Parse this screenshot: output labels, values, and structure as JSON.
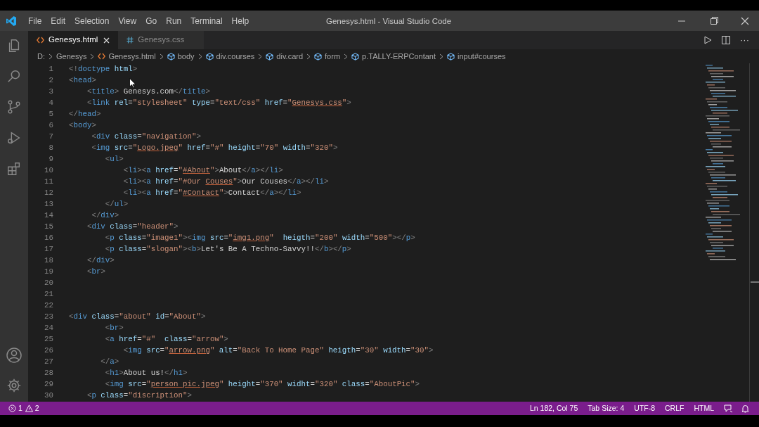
{
  "window": {
    "title": "Genesys.html - Visual Studio Code"
  },
  "menu": [
    "File",
    "Edit",
    "Selection",
    "View",
    "Go",
    "Run",
    "Terminal",
    "Help"
  ],
  "tabs": [
    {
      "label": "Genesys.html",
      "kind": "html",
      "selected": true
    },
    {
      "label": "Genesys.css",
      "kind": "css",
      "selected": false
    }
  ],
  "more_actions": "···",
  "breadcrumbs": [
    {
      "label": "D:",
      "kind": "folder"
    },
    {
      "label": "Genesys",
      "kind": "folder"
    },
    {
      "label": "Genesys.html",
      "kind": "html"
    },
    {
      "label": "body",
      "kind": "symbol"
    },
    {
      "label": "div.courses",
      "kind": "symbol"
    },
    {
      "label": "div.card",
      "kind": "symbol"
    },
    {
      "label": "form",
      "kind": "symbol"
    },
    {
      "label": "p.TALLY-ERPContant",
      "kind": "symbol"
    },
    {
      "label": "input#courses",
      "kind": "symbol"
    }
  ],
  "editor": {
    "lines": [
      {
        "number": "1",
        "tokens": [
          {
            "kind": "punct",
            "text": "<!"
          },
          {
            "kind": "tag",
            "text": "doctype"
          },
          {
            "kind": "attr",
            "text": " html"
          },
          {
            "kind": "punct",
            "text": ">"
          }
        ]
      },
      {
        "number": "2",
        "tokens": [
          {
            "kind": "punct",
            "text": "<"
          },
          {
            "kind": "tag",
            "text": "head"
          },
          {
            "kind": "punct",
            "text": ">"
          }
        ]
      },
      {
        "number": "3",
        "tokens": [
          {
            "kind": "punct",
            "text": "    <"
          },
          {
            "kind": "tag",
            "text": "title"
          },
          {
            "kind": "punct",
            "text": ">"
          },
          {
            "kind": "text",
            "text": " Genesys.com"
          },
          {
            "kind": "punct",
            "text": "</"
          },
          {
            "kind": "tag",
            "text": "title"
          },
          {
            "kind": "punct",
            "text": ">"
          }
        ]
      },
      {
        "number": "4",
        "tokens": [
          {
            "kind": "punct",
            "text": "    <"
          },
          {
            "kind": "tag",
            "text": "link"
          },
          {
            "kind": "attr",
            "text": " rel"
          },
          {
            "kind": "text",
            "text": "="
          },
          {
            "kind": "string",
            "text": "\"stylesheet\""
          },
          {
            "kind": "attr",
            "text": " type"
          },
          {
            "kind": "text",
            "text": "="
          },
          {
            "kind": "string",
            "text": "\"text/css\""
          },
          {
            "kind": "attr",
            "text": " href"
          },
          {
            "kind": "text",
            "text": "="
          },
          {
            "kind": "string",
            "text": "\""
          },
          {
            "kind": "link",
            "text": "Genesys.css"
          },
          {
            "kind": "string",
            "text": "\""
          },
          {
            "kind": "punct",
            "text": ">"
          }
        ]
      },
      {
        "number": "5",
        "tokens": [
          {
            "kind": "punct",
            "text": "</"
          },
          {
            "kind": "tag",
            "text": "head"
          },
          {
            "kind": "punct",
            "text": ">"
          }
        ]
      },
      {
        "number": "6",
        "tokens": [
          {
            "kind": "punct",
            "text": "<"
          },
          {
            "kind": "tag",
            "text": "body"
          },
          {
            "kind": "punct",
            "text": ">"
          }
        ]
      },
      {
        "number": "7",
        "tokens": [
          {
            "kind": "punct",
            "text": "     <"
          },
          {
            "kind": "tag",
            "text": "div"
          },
          {
            "kind": "attr",
            "text": " class"
          },
          {
            "kind": "text",
            "text": "="
          },
          {
            "kind": "string",
            "text": "\"navigation\""
          },
          {
            "kind": "punct",
            "text": ">"
          }
        ]
      },
      {
        "number": "8",
        "tokens": [
          {
            "kind": "punct",
            "text": "     <"
          },
          {
            "kind": "tag",
            "text": "img"
          },
          {
            "kind": "attr",
            "text": " src"
          },
          {
            "kind": "text",
            "text": "="
          },
          {
            "kind": "string",
            "text": "\""
          },
          {
            "kind": "link",
            "text": "Logo.jpeg"
          },
          {
            "kind": "string",
            "text": "\""
          },
          {
            "kind": "attr",
            "text": " href"
          },
          {
            "kind": "text",
            "text": "="
          },
          {
            "kind": "string",
            "text": "\"#\""
          },
          {
            "kind": "attr",
            "text": " height"
          },
          {
            "kind": "text",
            "text": "="
          },
          {
            "kind": "string",
            "text": "\"70\""
          },
          {
            "kind": "attr",
            "text": " width"
          },
          {
            "kind": "text",
            "text": "="
          },
          {
            "kind": "string",
            "text": "\"320\""
          },
          {
            "kind": "punct",
            "text": ">"
          }
        ]
      },
      {
        "number": "9",
        "tokens": [
          {
            "kind": "punct",
            "text": "        <"
          },
          {
            "kind": "tag",
            "text": "ul"
          },
          {
            "kind": "punct",
            "text": ">"
          }
        ]
      },
      {
        "number": "10",
        "tokens": [
          {
            "kind": "punct",
            "text": "            <"
          },
          {
            "kind": "tag",
            "text": "li"
          },
          {
            "kind": "punct",
            "text": "><"
          },
          {
            "kind": "tag",
            "text": "a"
          },
          {
            "kind": "attr",
            "text": " href"
          },
          {
            "kind": "text",
            "text": "="
          },
          {
            "kind": "string",
            "text": "\""
          },
          {
            "kind": "link",
            "text": "#About"
          },
          {
            "kind": "string",
            "text": "\""
          },
          {
            "kind": "punct",
            "text": ">"
          },
          {
            "kind": "text",
            "text": "About"
          },
          {
            "kind": "punct",
            "text": "</"
          },
          {
            "kind": "tag",
            "text": "a"
          },
          {
            "kind": "punct",
            "text": "></"
          },
          {
            "kind": "tag",
            "text": "li"
          },
          {
            "kind": "punct",
            "text": ">"
          }
        ]
      },
      {
        "number": "11",
        "tokens": [
          {
            "kind": "punct",
            "text": "            <"
          },
          {
            "kind": "tag",
            "text": "li"
          },
          {
            "kind": "punct",
            "text": "><"
          },
          {
            "kind": "tag",
            "text": "a"
          },
          {
            "kind": "attr",
            "text": " href"
          },
          {
            "kind": "text",
            "text": "="
          },
          {
            "kind": "string",
            "text": "\"#Our "
          },
          {
            "kind": "link",
            "text": "Couses"
          },
          {
            "kind": "string",
            "text": "\""
          },
          {
            "kind": "punct",
            "text": ">"
          },
          {
            "kind": "text",
            "text": "Our Couses"
          },
          {
            "kind": "punct",
            "text": "</"
          },
          {
            "kind": "tag",
            "text": "a"
          },
          {
            "kind": "punct",
            "text": "></"
          },
          {
            "kind": "tag",
            "text": "li"
          },
          {
            "kind": "punct",
            "text": ">"
          }
        ]
      },
      {
        "number": "12",
        "tokens": [
          {
            "kind": "punct",
            "text": "            <"
          },
          {
            "kind": "tag",
            "text": "li"
          },
          {
            "kind": "punct",
            "text": "><"
          },
          {
            "kind": "tag",
            "text": "a"
          },
          {
            "kind": "attr",
            "text": " href"
          },
          {
            "kind": "text",
            "text": "="
          },
          {
            "kind": "string",
            "text": "\""
          },
          {
            "kind": "link",
            "text": "#Contact"
          },
          {
            "kind": "string",
            "text": "\""
          },
          {
            "kind": "punct",
            "text": ">"
          },
          {
            "kind": "text",
            "text": "Contact"
          },
          {
            "kind": "punct",
            "text": "</"
          },
          {
            "kind": "tag",
            "text": "a"
          },
          {
            "kind": "punct",
            "text": "></"
          },
          {
            "kind": "tag",
            "text": "li"
          },
          {
            "kind": "punct",
            "text": ">"
          }
        ]
      },
      {
        "number": "13",
        "tokens": [
          {
            "kind": "punct",
            "text": "        </"
          },
          {
            "kind": "tag",
            "text": "ul"
          },
          {
            "kind": "punct",
            "text": ">"
          }
        ]
      },
      {
        "number": "14",
        "tokens": [
          {
            "kind": "punct",
            "text": "     </"
          },
          {
            "kind": "tag",
            "text": "div"
          },
          {
            "kind": "punct",
            "text": ">"
          }
        ]
      },
      {
        "number": "15",
        "tokens": [
          {
            "kind": "punct",
            "text": "    <"
          },
          {
            "kind": "tag",
            "text": "div"
          },
          {
            "kind": "attr",
            "text": " class"
          },
          {
            "kind": "text",
            "text": "="
          },
          {
            "kind": "string",
            "text": "\"header\""
          },
          {
            "kind": "punct",
            "text": ">"
          }
        ]
      },
      {
        "number": "16",
        "tokens": [
          {
            "kind": "punct",
            "text": "        <"
          },
          {
            "kind": "tag",
            "text": "p"
          },
          {
            "kind": "attr",
            "text": " class"
          },
          {
            "kind": "text",
            "text": "="
          },
          {
            "kind": "string",
            "text": "\"image1\""
          },
          {
            "kind": "punct",
            "text": "><"
          },
          {
            "kind": "tag",
            "text": "img"
          },
          {
            "kind": "attr",
            "text": " src"
          },
          {
            "kind": "text",
            "text": "="
          },
          {
            "kind": "string",
            "text": "\""
          },
          {
            "kind": "link",
            "text": "img1.png"
          },
          {
            "kind": "string",
            "text": "\""
          },
          {
            "kind": "attr",
            "text": "  heigth"
          },
          {
            "kind": "text",
            "text": "="
          },
          {
            "kind": "string",
            "text": "\"200\""
          },
          {
            "kind": "attr",
            "text": " width"
          },
          {
            "kind": "text",
            "text": "="
          },
          {
            "kind": "string",
            "text": "\"500\""
          },
          {
            "kind": "punct",
            "text": "></"
          },
          {
            "kind": "tag",
            "text": "p"
          },
          {
            "kind": "punct",
            "text": ">"
          }
        ]
      },
      {
        "number": "17",
        "tokens": [
          {
            "kind": "punct",
            "text": "        <"
          },
          {
            "kind": "tag",
            "text": "p"
          },
          {
            "kind": "attr",
            "text": " class"
          },
          {
            "kind": "text",
            "text": "="
          },
          {
            "kind": "string",
            "text": "\"slogan\""
          },
          {
            "kind": "punct",
            "text": "><"
          },
          {
            "kind": "tag",
            "text": "b"
          },
          {
            "kind": "punct",
            "text": ">"
          },
          {
            "kind": "text",
            "text": "Let's Be A Techno-Savvy!!"
          },
          {
            "kind": "punct",
            "text": "</"
          },
          {
            "kind": "tag",
            "text": "b"
          },
          {
            "kind": "punct",
            "text": "></"
          },
          {
            "kind": "tag",
            "text": "p"
          },
          {
            "kind": "punct",
            "text": ">"
          }
        ]
      },
      {
        "number": "18",
        "tokens": [
          {
            "kind": "punct",
            "text": "    </"
          },
          {
            "kind": "tag",
            "text": "div"
          },
          {
            "kind": "punct",
            "text": ">"
          }
        ]
      },
      {
        "number": "19",
        "tokens": [
          {
            "kind": "punct",
            "text": "    <"
          },
          {
            "kind": "tag",
            "text": "br"
          },
          {
            "kind": "punct",
            "text": ">"
          }
        ]
      },
      {
        "number": "20"
      },
      {
        "number": "21"
      },
      {
        "number": "22"
      },
      {
        "number": "23",
        "tokens": [
          {
            "kind": "punct",
            "text": "<"
          },
          {
            "kind": "tag",
            "text": "div"
          },
          {
            "kind": "attr",
            "text": " class"
          },
          {
            "kind": "text",
            "text": "="
          },
          {
            "kind": "string",
            "text": "\"about\""
          },
          {
            "kind": "attr",
            "text": " id"
          },
          {
            "kind": "text",
            "text": "="
          },
          {
            "kind": "string",
            "text": "\"About\""
          },
          {
            "kind": "punct",
            "text": ">"
          }
        ]
      },
      {
        "number": "24",
        "tokens": [
          {
            "kind": "punct",
            "text": "        <"
          },
          {
            "kind": "tag",
            "text": "br"
          },
          {
            "kind": "punct",
            "text": ">"
          }
        ]
      },
      {
        "number": "25",
        "tokens": [
          {
            "kind": "punct",
            "text": "        <"
          },
          {
            "kind": "tag",
            "text": "a"
          },
          {
            "kind": "attr",
            "text": " href"
          },
          {
            "kind": "text",
            "text": "="
          },
          {
            "kind": "string",
            "text": "\"#\""
          },
          {
            "kind": "attr",
            "text": "  class"
          },
          {
            "kind": "text",
            "text": "="
          },
          {
            "kind": "string",
            "text": "\"arrow\""
          },
          {
            "kind": "punct",
            "text": ">"
          }
        ]
      },
      {
        "number": "26",
        "tokens": [
          {
            "kind": "punct",
            "text": "            <"
          },
          {
            "kind": "tag",
            "text": "img"
          },
          {
            "kind": "attr",
            "text": " src"
          },
          {
            "kind": "text",
            "text": "="
          },
          {
            "kind": "string",
            "text": "\""
          },
          {
            "kind": "link",
            "text": "arrow.png"
          },
          {
            "kind": "string",
            "text": "\""
          },
          {
            "kind": "attr",
            "text": " alt"
          },
          {
            "kind": "text",
            "text": "="
          },
          {
            "kind": "string",
            "text": "\"Back To Home Page\""
          },
          {
            "kind": "attr",
            "text": " heigth"
          },
          {
            "kind": "text",
            "text": "="
          },
          {
            "kind": "string",
            "text": "\"30\""
          },
          {
            "kind": "attr",
            "text": " width"
          },
          {
            "kind": "text",
            "text": "="
          },
          {
            "kind": "string",
            "text": "\"30\""
          },
          {
            "kind": "punct",
            "text": ">"
          }
        ]
      },
      {
        "number": "27",
        "tokens": [
          {
            "kind": "punct",
            "text": "       </"
          },
          {
            "kind": "tag",
            "text": "a"
          },
          {
            "kind": "punct",
            "text": ">"
          }
        ]
      },
      {
        "number": "28",
        "tokens": [
          {
            "kind": "punct",
            "text": "        <"
          },
          {
            "kind": "tag",
            "text": "h1"
          },
          {
            "kind": "punct",
            "text": ">"
          },
          {
            "kind": "text",
            "text": "About us!"
          },
          {
            "kind": "punct",
            "text": "</"
          },
          {
            "kind": "tag",
            "text": "h1"
          },
          {
            "kind": "punct",
            "text": ">"
          }
        ]
      },
      {
        "number": "29",
        "tokens": [
          {
            "kind": "punct",
            "text": "        <"
          },
          {
            "kind": "tag",
            "text": "img"
          },
          {
            "kind": "attr",
            "text": " src"
          },
          {
            "kind": "text",
            "text": "="
          },
          {
            "kind": "string",
            "text": "\""
          },
          {
            "kind": "link",
            "text": "person pic.jpeg"
          },
          {
            "kind": "string",
            "text": "\""
          },
          {
            "kind": "attr",
            "text": " height"
          },
          {
            "kind": "text",
            "text": "="
          },
          {
            "kind": "string",
            "text": "\"370\""
          },
          {
            "kind": "attr",
            "text": " widht"
          },
          {
            "kind": "text",
            "text": "="
          },
          {
            "kind": "string",
            "text": "\"320\""
          },
          {
            "kind": "attr",
            "text": " class"
          },
          {
            "kind": "text",
            "text": "="
          },
          {
            "kind": "string",
            "text": "\"AboutPic\""
          },
          {
            "kind": "punct",
            "text": ">"
          }
        ]
      },
      {
        "number": "30",
        "tokens": [
          {
            "kind": "punct",
            "text": "    <"
          },
          {
            "kind": "tag",
            "text": "p"
          },
          {
            "kind": "attr",
            "text": " class"
          },
          {
            "kind": "text",
            "text": "="
          },
          {
            "kind": "string",
            "text": "\"discription\""
          },
          {
            "kind": "punct",
            "text": ">"
          }
        ]
      }
    ]
  },
  "status_bar": {
    "errors": "1",
    "warnings": "2",
    "items": [
      "Ln 182, Col 75",
      "Tab Size: 4",
      "UTF-8",
      "CRLF",
      "HTML"
    ]
  }
}
